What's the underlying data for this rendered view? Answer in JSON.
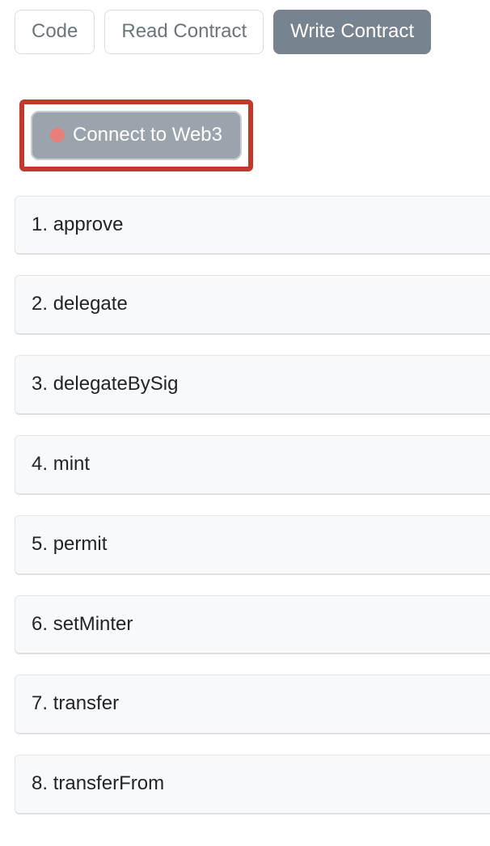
{
  "tabs": [
    {
      "label": "Code",
      "active": false
    },
    {
      "label": "Read Contract",
      "active": false
    },
    {
      "label": "Write Contract",
      "active": true
    }
  ],
  "connect": {
    "label": "Connect to Web3",
    "status_color": "#e87f7a"
  },
  "functions": [
    {
      "index": 1,
      "name": "approve"
    },
    {
      "index": 2,
      "name": "delegate"
    },
    {
      "index": 3,
      "name": "delegateBySig"
    },
    {
      "index": 4,
      "name": "mint"
    },
    {
      "index": 5,
      "name": "permit"
    },
    {
      "index": 6,
      "name": "setMinter"
    },
    {
      "index": 7,
      "name": "transfer"
    },
    {
      "index": 8,
      "name": "transferFrom"
    }
  ]
}
